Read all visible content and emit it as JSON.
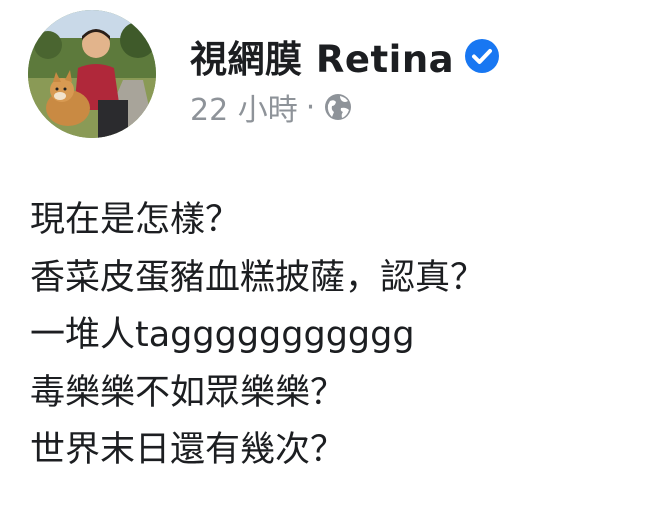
{
  "post": {
    "author": {
      "name": "視網膜 Retina",
      "verified_icon": "verified-badge-icon",
      "avatar_icon": "avatar-photo"
    },
    "meta": {
      "time": "22 小時",
      "separator": "·",
      "audience_icon": "globe-icon"
    },
    "lines": [
      "現在是怎樣？",
      "香菜皮蛋豬血糕披薩，認真？",
      "一堆人taggggggggggg",
      "毒樂樂不如眾樂樂？",
      "世界末日還有幾次？"
    ]
  },
  "colors": {
    "verified_blue": "#1877f2",
    "meta_gray": "#8e9399",
    "text": "#1c1e21"
  }
}
